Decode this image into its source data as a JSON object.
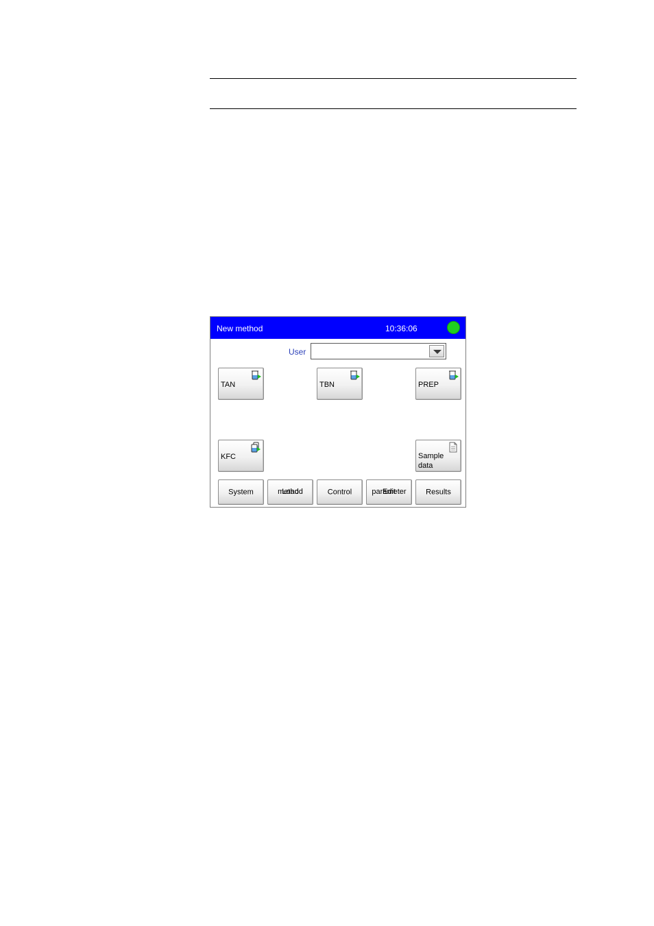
{
  "window": {
    "title": "New method",
    "time": "10:36:06",
    "status_color": "#1fcf1f",
    "title_bar_color": "#0000ff"
  },
  "user": {
    "label": "User",
    "value": ""
  },
  "methods": [
    {
      "label": "TAN",
      "icon": "beaker-start-icon"
    },
    {
      "label": "TBN",
      "icon": "beaker-start-icon"
    },
    {
      "label": "PREP",
      "icon": "beaker-start-icon"
    },
    {
      "label": "KFC",
      "icon": "dual-beaker-start-icon"
    }
  ],
  "sample_data": {
    "line1": "Sample",
    "line2": "data",
    "icon": "document-icon"
  },
  "nav": {
    "system": "System",
    "load_line1": "Load",
    "load_line2": "method",
    "control": "Control",
    "edit_line1": "Edit",
    "edit_line2": "parameter",
    "results": "Results"
  }
}
